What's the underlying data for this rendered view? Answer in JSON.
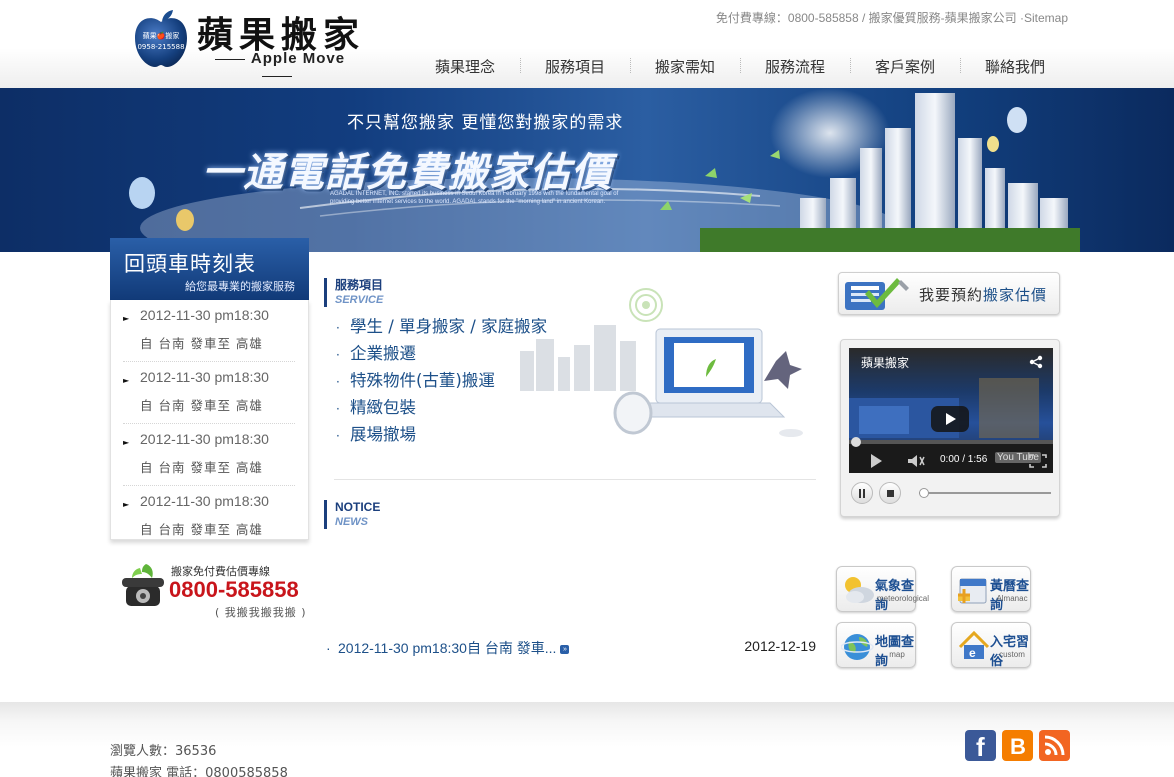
{
  "header": {
    "logo_title": "蘋果搬家",
    "logo_sub": "Apple Move",
    "logo_badge_line1": "蘋果🍎搬家",
    "logo_badge_line2": "0958-215588",
    "topline": "免付費專線：0800-585858 / 搬家優質服務-蘋果搬家公司 ·Sitemap",
    "nav": [
      {
        "label": "蘋果理念"
      },
      {
        "label": "服務項目"
      },
      {
        "label": "搬家需知"
      },
      {
        "label": "服務流程"
      },
      {
        "label": "客戶案例"
      },
      {
        "label": "聯絡我們"
      }
    ]
  },
  "banner": {
    "tagline": "不只幫您搬家 更懂您對搬家的需求",
    "headline": "一通電話免費搬家估價",
    "small_print": "AGADAL INTERNET, INC. started its business in Seoul Korea in February 1998 with the fundamental goal of providing better internet services to the world. AGADAL stands for the \"morning land\" in ancient Korean."
  },
  "schedule": {
    "title": "回頭車時刻表",
    "subtitle": "給您最專業的搬家服務",
    "items": [
      {
        "date": "2012-11-30 pm18:30",
        "route": "自 台南 發車至 高雄"
      },
      {
        "date": "2012-11-30 pm18:30",
        "route": "自 台南 發車至 高雄"
      },
      {
        "date": "2012-11-30 pm18:30",
        "route": "自 台南 發車至 高雄"
      },
      {
        "date": "2012-11-30 pm18:30",
        "route": "自 台南 發車至 高雄"
      }
    ]
  },
  "hotline": {
    "label": "搬家免付費估價專線",
    "number": "0800-585858",
    "note": "( 我搬我搬我搬 )"
  },
  "services": {
    "heading_cn": "服務項目",
    "heading_en": "SERVICE",
    "items": [
      "學生 / 單身搬家 / 家庭搬家",
      "企業搬遷",
      "特殊物件(古董)搬運",
      "精緻包裝",
      "展場撤場"
    ]
  },
  "news": {
    "heading_cn": "NOTICE",
    "heading_en": "NEWS",
    "items": [
      {
        "text": "2012-11-30 pm18:30自 台南 發車...",
        "date": "2012-12-19"
      }
    ]
  },
  "quote_button": {
    "prefix": "我要預約",
    "highlight": "搬家估價"
  },
  "video": {
    "title": "蘋果搬家",
    "time": "0:00 / 1:56",
    "brand": "You Tube"
  },
  "quick_links": [
    {
      "title": "氣象查詢",
      "sub": "meteorological"
    },
    {
      "title": "黃曆查詢",
      "sub": "Almanac"
    },
    {
      "title": "地圖查詢",
      "sub": "map"
    },
    {
      "title": "入宅習俗",
      "sub": "custom"
    }
  ],
  "footer": {
    "visitors": "瀏覽人數：36536",
    "contact": "蘋果搬家 電話：0800585858"
  },
  "colors": {
    "brand_blue": "#1b3f7d",
    "hotline_red": "#c8151b",
    "facebook": "#3b5998",
    "blogger": "#f57d00",
    "rss": "#f26522"
  }
}
